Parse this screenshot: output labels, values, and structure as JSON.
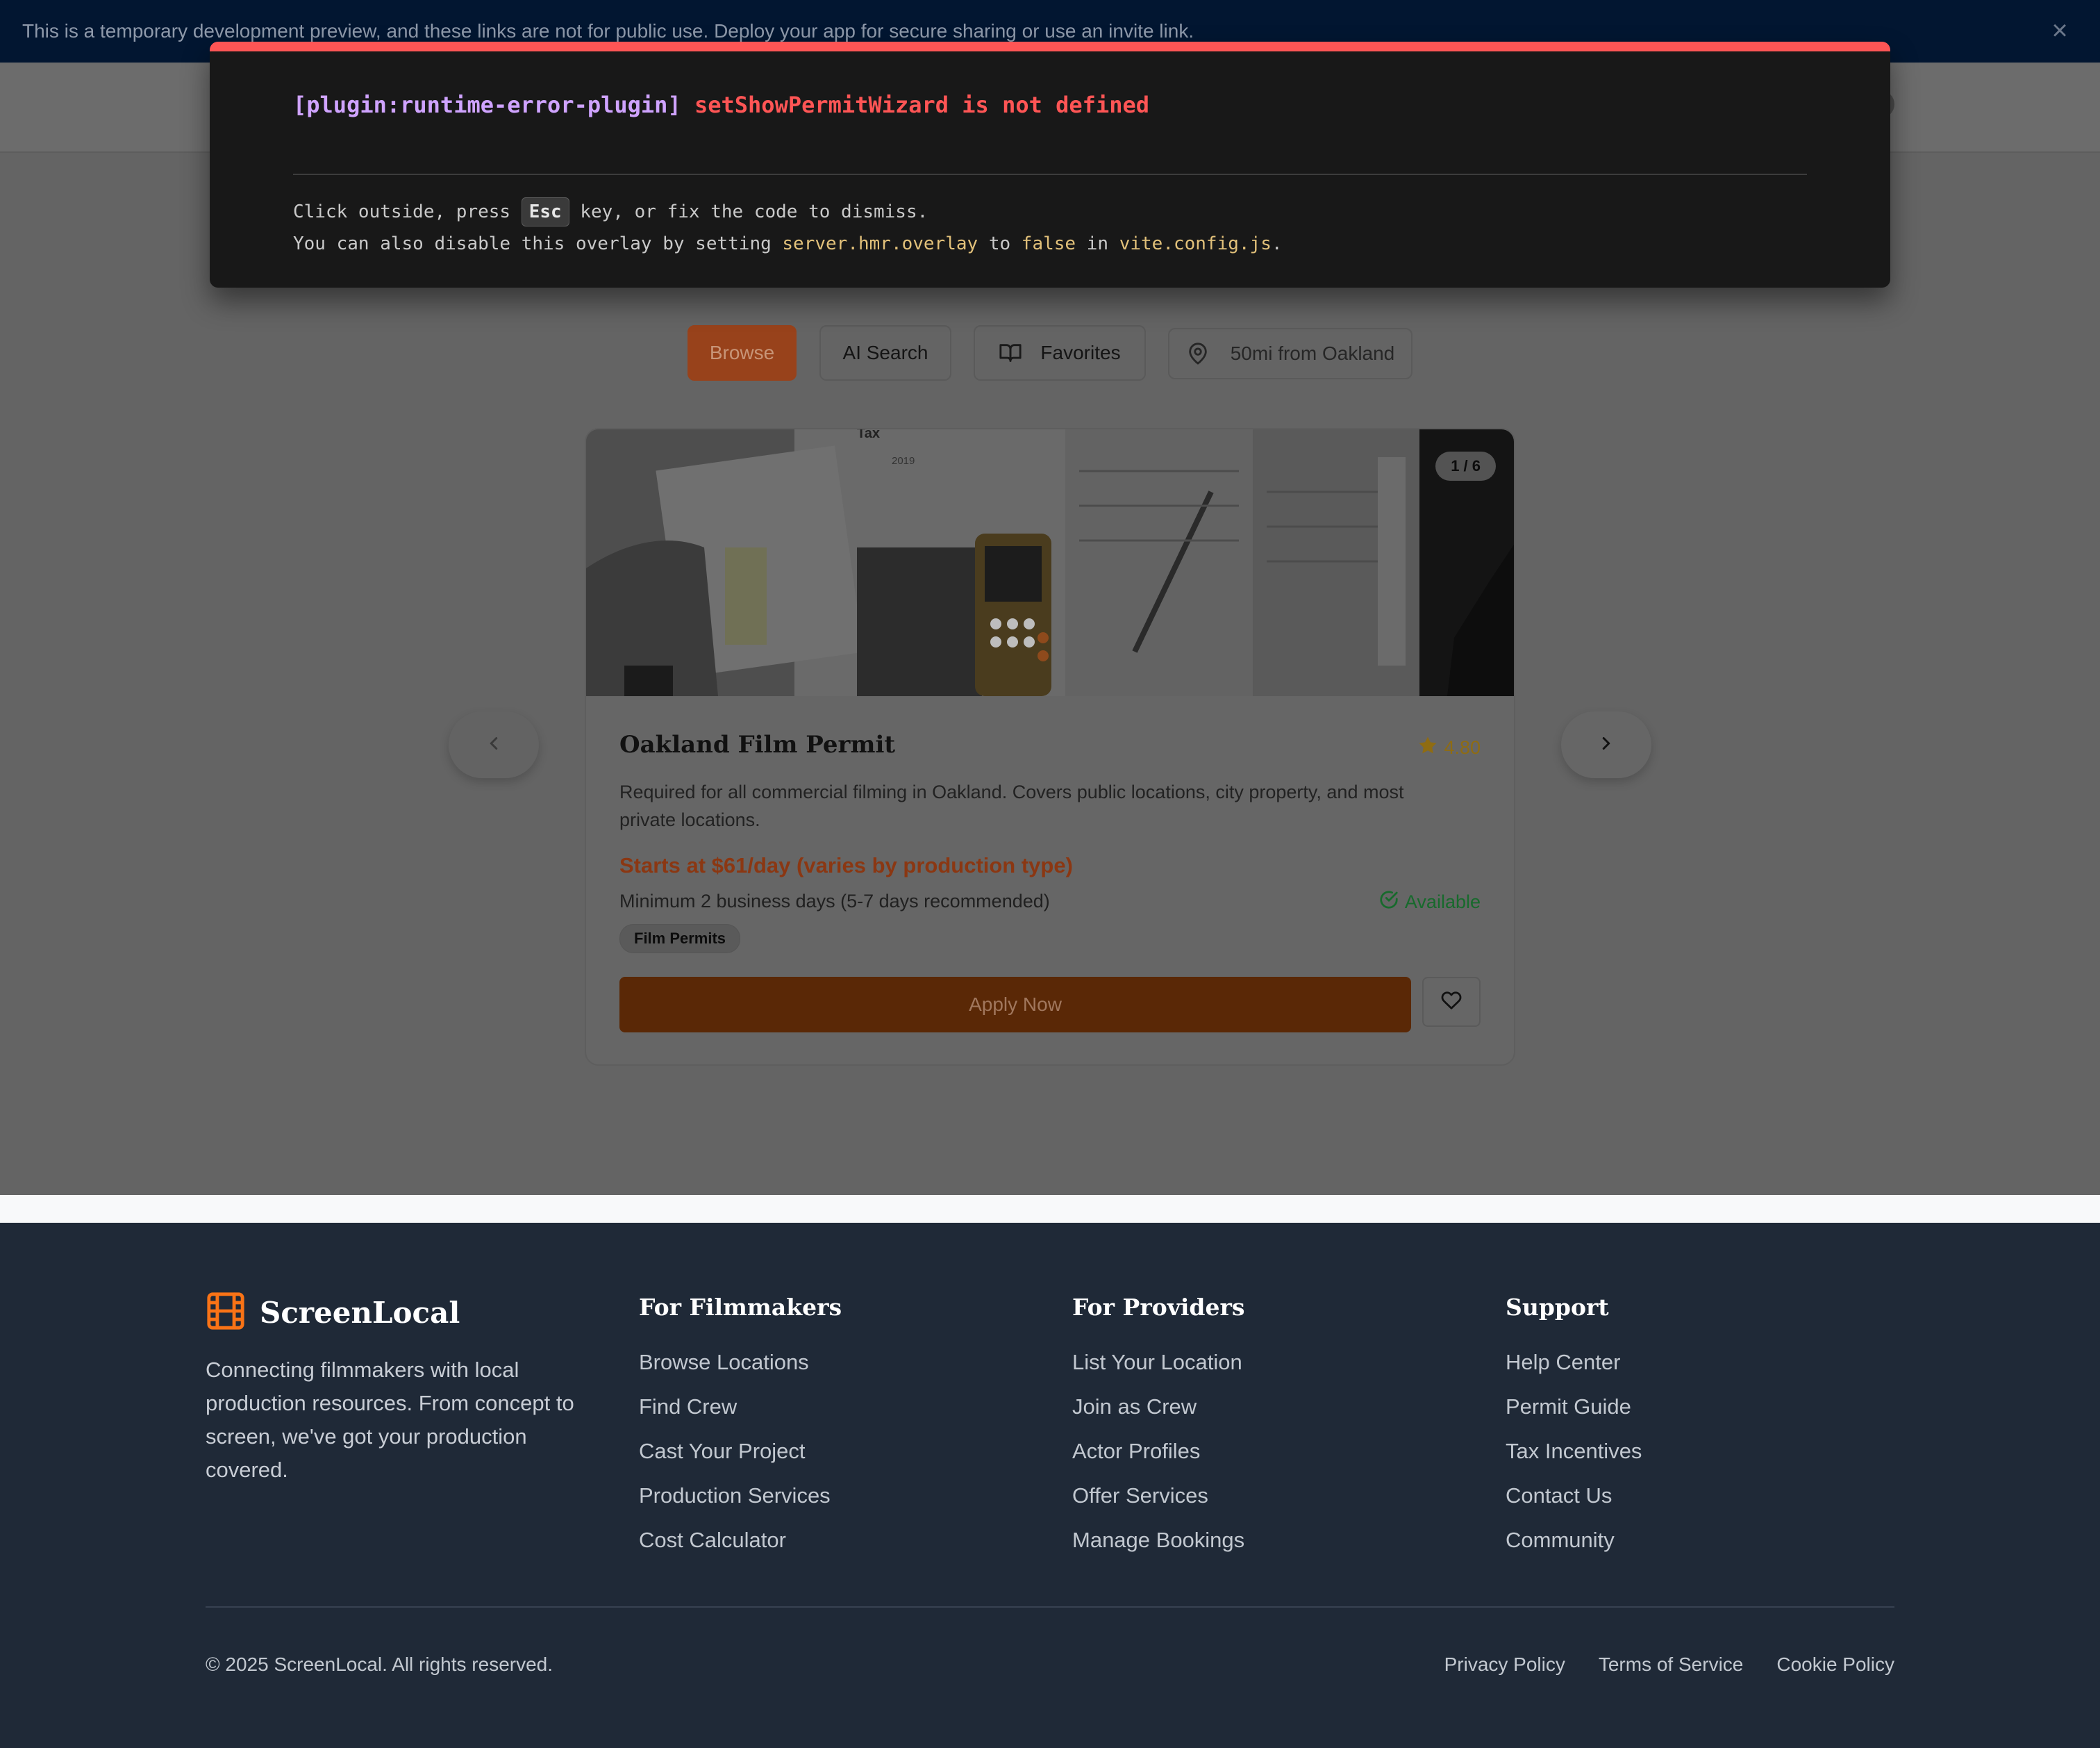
{
  "dev_banner": {
    "text": "This is a temporary development preview, and these links are not for public use. Deploy your app for secure sharing or use an invite link.",
    "close_icon": "close-icon"
  },
  "error_overlay": {
    "plugin": "[plugin:runtime-error-plugin]",
    "message": "setShowPermitWizard is not defined",
    "tip_line1_pre": "Click outside, press",
    "tip_key": "Esc",
    "tip_line1_post": "key, or fix the code to dismiss.",
    "tip_line2_pre": "You can also disable this overlay by setting",
    "tip_code1": "server.hmr.overlay",
    "tip_to": "to",
    "tip_code2": "false",
    "tip_in": "in",
    "tip_code3": "vite.config.js",
    "tip_end": ".",
    "accent_color": "#ff5555"
  },
  "filters": {
    "browse": "Browse",
    "ai_search": "AI Search",
    "favorites": "Favorites",
    "location": "50mi from Oakland"
  },
  "card": {
    "image_counter": "1 / 6",
    "title": "Oakland Film Permit",
    "rating": "4.80",
    "description": "Required for all commercial filming in Oakland. Covers public locations, city property, and most private locations.",
    "price": "Starts at $61/day (varies by production type)",
    "minimum": "Minimum 2 business days (5-7 days recommended)",
    "availability": "Available",
    "tag": "Film Permits",
    "apply_label": "Apply Now",
    "accent_color": "#ea580c"
  },
  "footer": {
    "brand": "ScreenLocal",
    "brand_desc": "Connecting filmmakers with local production resources. From concept to screen, we've got your production covered.",
    "columns": [
      {
        "title": "For Filmmakers",
        "links": [
          "Browse Locations",
          "Find Crew",
          "Cast Your Project",
          "Production Services",
          "Cost Calculator"
        ]
      },
      {
        "title": "For Providers",
        "links": [
          "List Your Location",
          "Join as Crew",
          "Actor Profiles",
          "Offer Services",
          "Manage Bookings"
        ]
      },
      {
        "title": "Support",
        "links": [
          "Help Center",
          "Permit Guide",
          "Tax Incentives",
          "Contact Us",
          "Community"
        ]
      }
    ],
    "copyright": "© 2025 ScreenLocal. All rights reserved.",
    "legal": [
      "Privacy Policy",
      "Terms of Service",
      "Cookie Policy"
    ]
  }
}
